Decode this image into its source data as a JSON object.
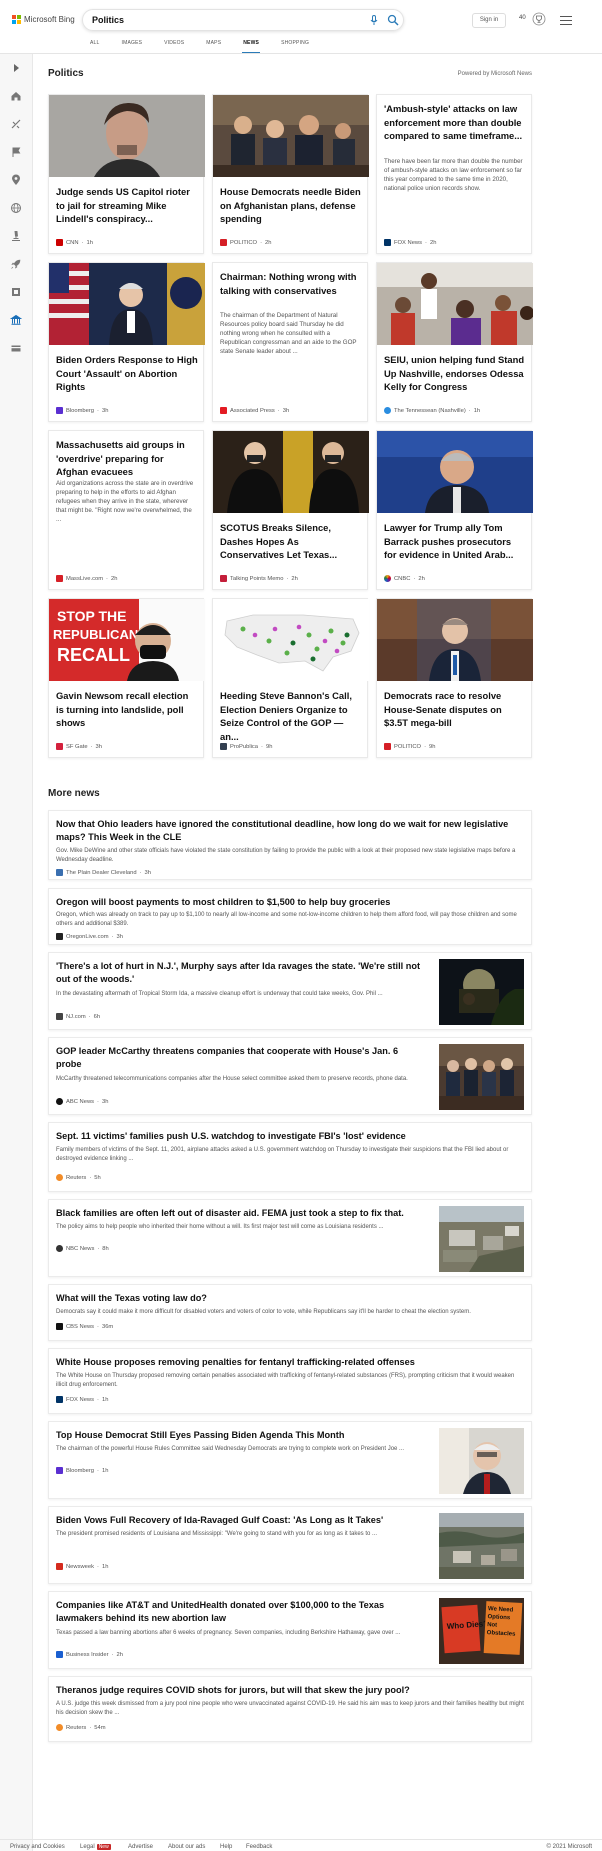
{
  "brand": "Microsoft Bing",
  "search": {
    "value": "Politics"
  },
  "header": {
    "signin_label": "Sign in",
    "points": "40"
  },
  "tabs": [
    {
      "label": "ALL"
    },
    {
      "label": "IMAGES"
    },
    {
      "label": "VIDEOS"
    },
    {
      "label": "MAPS"
    },
    {
      "label": "NEWS",
      "active": true
    },
    {
      "label": "SHOPPING"
    }
  ],
  "politics": {
    "title": "Politics",
    "powered_by": "Powered by Microsoft News",
    "cards": [
      {
        "title": "Judge sends US Capitol rioter to jail for streaming Mike Lindell's conspiracy...",
        "source": "CNN",
        "time": "1h",
        "has_image": true,
        "logo_color": "#cc0000"
      },
      {
        "title": "House Democrats needle Biden on Afghanistan plans, defense spending",
        "source": "POLITICO",
        "time": "2h",
        "has_image": true,
        "logo_color": "#d51f26"
      },
      {
        "title": "'Ambush-style' attacks on law enforcement more than double compared to same timeframe...",
        "snippet": "There have been far more than double the number of ambush-style attacks on law enforcement so far this year compared to the same time in 2020, national police union records show.",
        "source": "FOX News",
        "time": "2h",
        "has_image": false,
        "logo_color": "#003366"
      },
      {
        "title": "Biden Orders Response to High Court 'Assault' on Abortion Rights",
        "source": "Bloomberg",
        "time": "3h",
        "has_image": true,
        "logo_color": "#5a2fd1"
      },
      {
        "title": "Chairman: Nothing wrong with talking with conservatives",
        "snippet": "The chairman of the Department of Natural Resources policy board said Thursday he did nothing wrong when he consulted with a Republican congressman and an aide to the GOP state Senate leader about ...",
        "source": "Associated Press",
        "time": "3h",
        "has_image": false,
        "logo_color": "#e31b23"
      },
      {
        "title": "SEIU, union helping fund Stand Up Nashville, endorses Odessa Kelly for Congress",
        "source": "The Tennessean (Nashville)",
        "time": "1h",
        "has_image": true,
        "logo_color": "#2a8de0"
      },
      {
        "title": "Massachusetts aid groups in 'overdrive' preparing for Afghan evacuees",
        "snippet": "Aid organizations across the state are in overdrive preparing to help in the efforts to aid Afghan refugees when they arrive in the state, wherever that might be. \"Right now we're overwhelmed, the ...",
        "source": "MassLive.com",
        "time": "2h",
        "has_image": false,
        "logo_color": "#d62027"
      },
      {
        "title": "SCOTUS Breaks Silence, Dashes Hopes As Conservatives Let Texas...",
        "source": "Talking Points Memo",
        "time": "2h",
        "has_image": true,
        "logo_color": "#c41e3a"
      },
      {
        "title": "Lawyer for Trump ally Tom Barrack pushes prosecutors for evidence in United Arab...",
        "source": "CNBC",
        "time": "2h",
        "has_image": true,
        "logo_color": "#e8a21a"
      },
      {
        "title": "Gavin Newsom recall election is turning into landslide, poll shows",
        "source": "SF Gate",
        "time": "3h",
        "has_image": true,
        "logo_color": "#d4213d"
      },
      {
        "title": "Heeding Steve Bannon's Call, Election Deniers Organize to Seize Control of the GOP — an...",
        "source": "ProPublica",
        "time": "9h",
        "has_image": true,
        "logo_color": "#333f50"
      },
      {
        "title": "Democrats race to resolve House-Senate disputes on $3.5T mega-bill",
        "source": "POLITICO",
        "time": "9h",
        "has_image": true,
        "logo_color": "#d51f26"
      }
    ],
    "recall_sign": {
      "line1": "STOP THE",
      "line2": "REPUBLICAN",
      "line3": "RECALL"
    }
  },
  "more_news": {
    "title": "More news",
    "items": [
      {
        "title": "Now that Ohio leaders have ignored the constitutional deadline, how long do we wait for new legislative maps? This Week in the CLE",
        "snippet": "Gov. Mike DeWine and other state officials have violated the state constitution by failing to provide the public with a look at their proposed new state legislative maps before a Wednesday deadline.",
        "source": "The Plain Dealer Cleveland",
        "time": "3h",
        "has_image": false,
        "logo_color": "#3a6fb0"
      },
      {
        "title": "Oregon will boost payments to most children to $1,500 to help buy groceries",
        "snippet": "Oregon, which was already on track to pay up to $1,100 to nearly all low-income and some not-low-income children to help them afford food, will pay those children and some others and additional $389.",
        "source": "OregonLive.com",
        "time": "3h",
        "has_image": false,
        "logo_color": "#222"
      },
      {
        "title": "'There's a lot of hurt in N.J.', Murphy says after Ida ravages the state. 'We're still not out of the woods.'",
        "snippet": "In the devastating aftermath of Tropical Storm Ida, a massive cleanup effort is underway that could take weeks, Gov. Phil ...",
        "source": "NJ.com",
        "time": "6h",
        "has_image": true,
        "logo_color": "#444"
      },
      {
        "title": "GOP leader McCarthy threatens companies that cooperate with House's Jan. 6 probe",
        "snippet": "McCarthy threatened telecommunications companies after the House select committee asked them to preserve records, phone data.",
        "source": "ABC News",
        "time": "3h",
        "has_image": true,
        "logo_color": "#111"
      },
      {
        "title": "Sept. 11 victims' families push U.S. watchdog to investigate FBI's 'lost' evidence",
        "snippet": "Family members of victims of the Sept. 11, 2001, airplane attacks asked a U.S. government watchdog on Thursday to investigate their suspicions that the FBI lied about or destroyed evidence linking ...",
        "source": "Reuters",
        "time": "5h",
        "has_image": false,
        "logo_color": "#f28c28"
      },
      {
        "title": "Black families are often left out of disaster aid. FEMA just took a step to fix that.",
        "snippet": "The policy aims to help people who inherited their home without a will. Its first major test will come as Louisiana residents ...",
        "source": "NBC News",
        "time": "8h",
        "has_image": true,
        "logo_color": "#333"
      },
      {
        "title": "What will the Texas voting law do?",
        "snippet": "Democrats say it could make it more difficult for disabled voters and voters of color to vote, while Republicans say it'll be harder to cheat the election system.",
        "source": "CBS News",
        "time": "36m",
        "has_image": false,
        "logo_color": "#111"
      },
      {
        "title": "White House proposes removing penalties for fentanyl trafficking-related offenses",
        "snippet": "The White House on Thursday proposed removing certain penalties associated with trafficking of fentanyl-related substances (FRS), prompting criticism that it would weaken illicit drug enforcement.",
        "source": "FOX News",
        "time": "1h",
        "has_image": false,
        "logo_color": "#003366"
      },
      {
        "title": "Top House Democrat Still Eyes Passing Biden Agenda This Month",
        "snippet": "The chairman of the powerful House Rules Committee said Wednesday Democrats are trying to complete work on President Joe ...",
        "source": "Bloomberg",
        "time": "1h",
        "has_image": true,
        "logo_color": "#5a2fd1"
      },
      {
        "title": "Biden Vows Full Recovery of Ida-Ravaged Gulf Coast: 'As Long as It Takes'",
        "snippet": "The president promised residents of Louisiana and Mississippi: \"We're going to stand with you for as long as it takes to ...",
        "source": "Newsweek",
        "time": "1h",
        "has_image": true,
        "logo_color": "#d52b1e"
      },
      {
        "title": "Companies like AT&T and UnitedHealth donated over $100,000 to the Texas lawmakers behind its new abortion law",
        "snippet": "Texas passed a law banning abortions after 6 weeks of pregnancy. Seven companies, including Berkshire Hathaway, gave over ...",
        "source": "Business Insider",
        "time": "2h",
        "has_image": true,
        "logo_color": "#1a5fd0"
      },
      {
        "title": "Theranos judge requires COVID shots for jurors, but will that skew the jury pool?",
        "snippet": "A U.S. judge this week dismissed from a jury pool nine people who were unvaccinated against COVID-19. He said his aim was to keep jurors and their families healthy but might his decision skew the ...",
        "source": "Reuters",
        "time": "54m",
        "has_image": false,
        "logo_color": "#f28c28"
      }
    ],
    "protest_signs": {
      "left": "Who Dies?",
      "right": "We Need Options Not Obstacles"
    }
  },
  "footer": {
    "links": [
      {
        "label": "Privacy and Cookies"
      },
      {
        "label": "Legal"
      },
      {
        "label": "Advertise"
      },
      {
        "label": "About our ads"
      },
      {
        "label": "Help"
      },
      {
        "label": "Feedback"
      }
    ],
    "new_badge": "New",
    "copyright": "© 2021 Microsoft"
  }
}
